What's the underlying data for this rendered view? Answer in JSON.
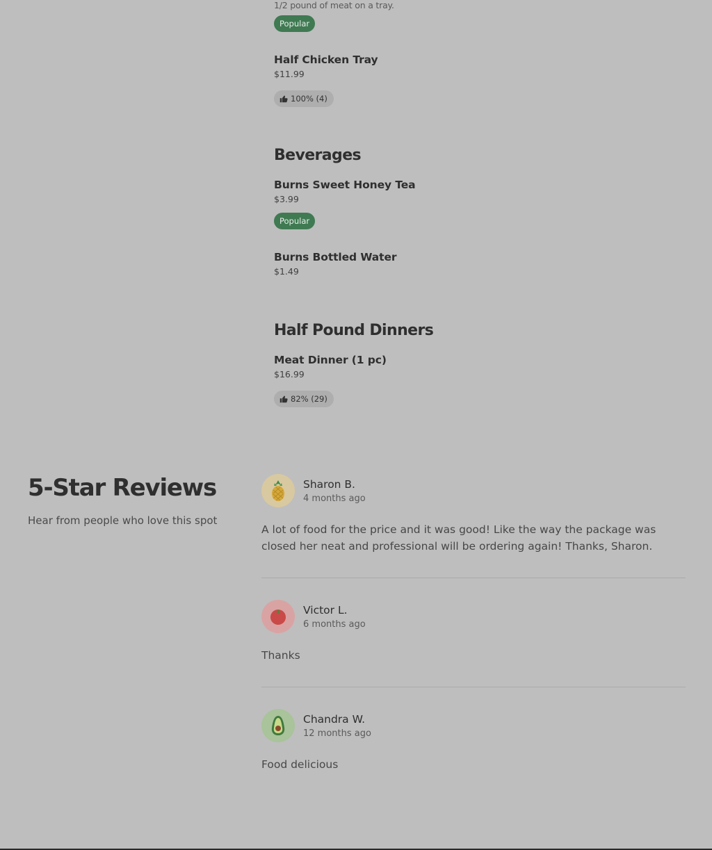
{
  "menu": {
    "top_item": {
      "description": "1/2 pound of meat on a tray.",
      "badge": "Popular"
    },
    "half_chicken": {
      "name": "Half Chicken Tray",
      "price": "$11.99",
      "rating": "100% (4)"
    },
    "beverages": {
      "title": "Beverages",
      "items": [
        {
          "name": "Burns Sweet Honey Tea",
          "price": "$3.99",
          "badge": "Popular"
        },
        {
          "name": "Burns Bottled Water",
          "price": "$1.49"
        }
      ]
    },
    "half_pound": {
      "title": "Half Pound Dinners",
      "items": [
        {
          "name": "Meat Dinner (1 pc)",
          "price": "$16.99",
          "rating": "82% (29)"
        }
      ]
    }
  },
  "reviews": {
    "title": "5-Star Reviews",
    "subtitle": "Hear from people who love this spot",
    "items": [
      {
        "name": "Sharon B.",
        "time": "4 months ago",
        "text": "A lot of food for the price and it was good! Like the way the package was closed her neat and professional will be ordering again! Thanks, Sharon.",
        "avatar_icon": "pineapple-icon",
        "avatar_bg": "#d9c9a0"
      },
      {
        "name": "Victor L.",
        "time": "6 months ago",
        "text": "Thanks",
        "avatar_icon": "tomato-icon",
        "avatar_bg": "#d9a3a3"
      },
      {
        "name": "Chandra W.",
        "time": "12 months ago",
        "text": "Food delicious",
        "avatar_icon": "avocado-icon",
        "avatar_bg": "#a9c39a"
      }
    ]
  },
  "colors": {
    "background": "#bebebe",
    "popular_badge": "#3f7a52",
    "rating_badge": "#aeaeae"
  }
}
